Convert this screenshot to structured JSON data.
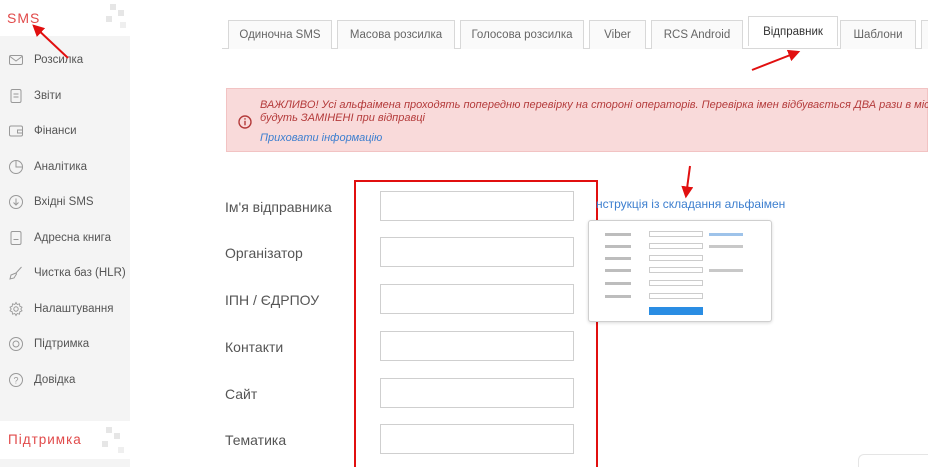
{
  "sidebar": {
    "brand": "SMS",
    "items": [
      {
        "label": "Розсилка",
        "icon": "envelope-icon"
      },
      {
        "label": "Звіти",
        "icon": "report-icon"
      },
      {
        "label": "Фінанси",
        "icon": "wallet-icon"
      },
      {
        "label": "Аналітика",
        "icon": "pie-chart-icon"
      },
      {
        "label": "Вхідні SMS",
        "icon": "incoming-icon"
      },
      {
        "label": "Адресна книга",
        "icon": "address-book-icon"
      },
      {
        "label": "Чистка баз (HLR)",
        "icon": "broom-icon"
      },
      {
        "label": "Налаштування",
        "icon": "gear-icon"
      },
      {
        "label": "Підтримка",
        "icon": "support-icon"
      },
      {
        "label": "Довідка",
        "icon": "help-icon"
      }
    ],
    "support_label": "Підтримка"
  },
  "tabs": [
    {
      "label": "Одиночна SMS",
      "active": false
    },
    {
      "label": "Масова розсилка",
      "active": false
    },
    {
      "label": "Голосова розсилка",
      "active": false
    },
    {
      "label": "Viber",
      "active": false
    },
    {
      "label": "RCS Android",
      "active": false
    },
    {
      "label": "Відправник",
      "active": true
    },
    {
      "label": "Шаблони",
      "active": false
    }
  ],
  "alert": {
    "line1": "ВАЖЛИВО! Усі альфаімена проходять попередню перевірку на стороні операторів. Перевірка імен відбувається ДВА рази в місяц",
    "line2": "будуть ЗАМІНЕНІ при відправці",
    "hide_link": "Приховати інформацію"
  },
  "form": {
    "fields": [
      {
        "label": "Ім'я відправника",
        "value": ""
      },
      {
        "label": "Організатор",
        "value": ""
      },
      {
        "label": "ІПН / ЄДРПОУ",
        "value": ""
      },
      {
        "label": "Контакти",
        "value": ""
      },
      {
        "label": "Сайт",
        "value": ""
      },
      {
        "label": "Тематика",
        "value": ""
      }
    ]
  },
  "instruction": {
    "link": "нструкція із складання альфаімен"
  },
  "colors": {
    "accent_red": "#e14a4a",
    "link_blue": "#3d7fcf",
    "alert_bg": "#f9dada",
    "highlight_frame": "#e10f0f"
  }
}
